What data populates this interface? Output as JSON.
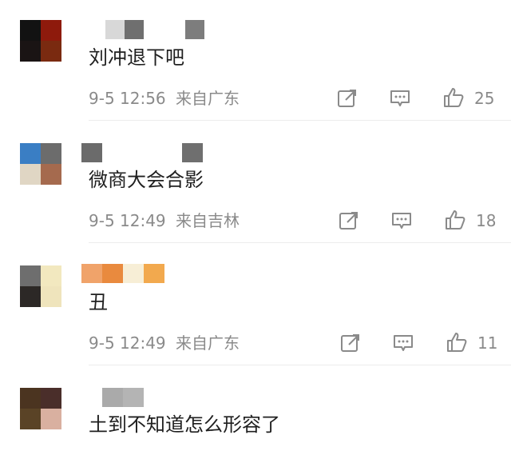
{
  "comments": [
    {
      "text": "刘冲退下吧",
      "time": "9-5 12:56",
      "location": "来自广东",
      "likes": "25",
      "avatar_colors": [
        "#121212",
        "#8e1a0c",
        "#1a1414",
        "#7a2a10"
      ],
      "name_colors": [
        "#d8d8d8",
        "#6f6f6f",
        "#7d7d7d"
      ]
    },
    {
      "text": "微商大会合影",
      "time": "9-5 12:49",
      "location": "来自吉林",
      "likes": "18",
      "avatar_colors": [
        "#3a7ec4",
        "#6c6c6c",
        "#e0d6c4",
        "#a56a4e"
      ],
      "name_colors": [
        "#6b6b6b",
        "#ffffff",
        "#6f6f6f"
      ]
    },
    {
      "text": "丑",
      "time": "9-5 12:49",
      "location": "来自广东",
      "likes": "11",
      "avatar_colors": [
        "#6e6e6e",
        "#f2e8bf",
        "#2c2826",
        "#efe4bc"
      ],
      "name_colors": [
        "#f0a36a",
        "#e98a3e",
        "#f7eed6",
        "#f2a94e"
      ]
    },
    {
      "text": "土到不知道怎么形容了",
      "time": "",
      "location": "",
      "likes": "",
      "avatar_colors": [
        "#4b3420",
        "#4a2e2a",
        "#5a4326",
        "#d9b0a0"
      ],
      "name_colors": [
        "#aaaaaa",
        "#b4b4b4"
      ]
    }
  ],
  "icons": {
    "share": "share-icon",
    "comment": "comment-icon",
    "like": "like-icon"
  },
  "colors": {
    "text": "#1f1f1f",
    "meta": "#8a8a8a",
    "icon": "#8a8a8a",
    "divider": "#ececec"
  }
}
